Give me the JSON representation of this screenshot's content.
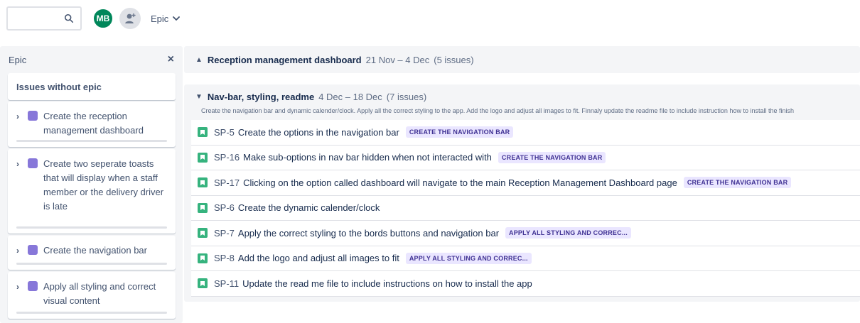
{
  "toolbar": {
    "search_placeholder": "",
    "avatar_initials": "MB",
    "group_by_label": "Epic",
    "avatar_color": "#00875a"
  },
  "epic_panel": {
    "title": "Epic",
    "close_glyph": "×",
    "no_epic_label": "Issues without epic",
    "epic_color": "#8777d9",
    "epics": [
      {
        "name": "Create the reception management dashboard"
      },
      {
        "name": "Create two seperate toasts that will display when a staff member or the delivery driver is late"
      },
      {
        "name": "Create the navigation bar"
      },
      {
        "name": "Apply all styling and correct visual content"
      }
    ]
  },
  "sprints": [
    {
      "name": "Reception management dashboard",
      "dates": "21 Nov – 4 Dec",
      "count": "(5 issues)",
      "expanded": false
    },
    {
      "name": "Nav-bar, styling, readme",
      "dates": "4 Dec – 18 Dec",
      "count": "(7 issues)",
      "expanded": true,
      "description": "Create the navigation bar and dynamic calender/clock. Apply all the correct styling to the app. Add the logo and adjust all images to fit. Finnaly update the readme file to include instruction how to install the finish",
      "issues": [
        {
          "key": "SP-5",
          "summary": "Create the options in the navigation bar",
          "epic": "CREATE THE NAVIGATION BAR"
        },
        {
          "key": "SP-16",
          "summary": "Make sub-options in nav bar hidden when not interacted with",
          "epic": "CREATE THE NAVIGATION BAR"
        },
        {
          "key": "SP-17",
          "summary": "Clicking on the option called dashboard will navigate to the main Reception Management Dashboard page",
          "epic": "CREATE THE NAVIGATION BAR"
        },
        {
          "key": "SP-6",
          "summary": "Create the dynamic calender/clock",
          "epic": ""
        },
        {
          "key": "SP-7",
          "summary": "Apply the correct styling to the bords buttons and navigation bar",
          "epic": "APPLY ALL STYLING AND CORREC..."
        },
        {
          "key": "SP-8",
          "summary": "Add the logo and adjust all images to fit",
          "epic": "APPLY ALL STYLING AND CORREC..."
        },
        {
          "key": "SP-11",
          "summary": "Update the read me file to include instructions on how to install the app",
          "epic": ""
        }
      ]
    }
  ]
}
